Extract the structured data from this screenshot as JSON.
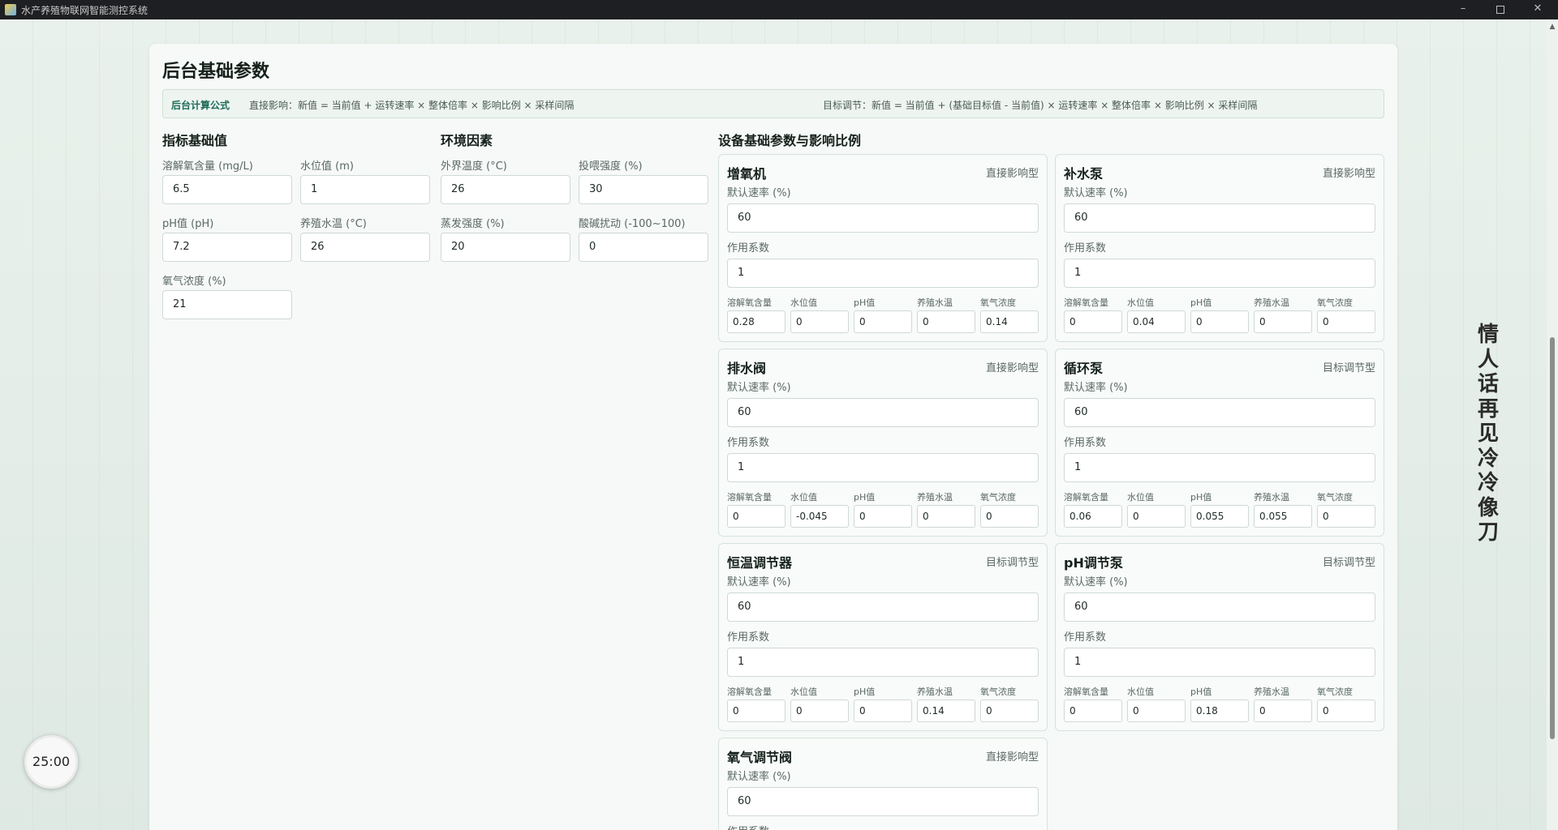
{
  "window": {
    "title": "水产养殖物联网智能测控系统",
    "minimize": "–",
    "close": "✕"
  },
  "page": {
    "title": "后台基础参数",
    "formula": {
      "label": "后台计算公式",
      "direct": "直接影响：新值 = 当前值 + 运转速率 × 整体倍率 × 影响比例 × 采样间隔",
      "target": "目标调节：新值 = 当前值 + (基础目标值 - 当前值) × 运转速率 × 整体倍率 × 影响比例 × 采样间隔"
    }
  },
  "indicators": {
    "title": "指标基础值",
    "fields": [
      {
        "label": "溶解氧含量 (mg/L)",
        "value": "6.5"
      },
      {
        "label": "水位值 (m)",
        "value": "1"
      },
      {
        "label": "pH值 (pH)",
        "value": "7.2"
      },
      {
        "label": "养殖水温 (°C)",
        "value": "26"
      },
      {
        "label": "氧气浓度 (%)",
        "value": "21"
      }
    ]
  },
  "environment": {
    "title": "环境因素",
    "fields": [
      {
        "label": "外界温度 (°C)",
        "value": "26"
      },
      {
        "label": "投喂强度 (%)",
        "value": "30"
      },
      {
        "label": "蒸发强度 (%)",
        "value": "20"
      },
      {
        "label": "酸碱扰动 (-100~100)",
        "value": "0"
      }
    ]
  },
  "devices": {
    "title": "设备基础参数与影响比例",
    "rate_label": "默认速率 (%)",
    "coef_label": "作用系数",
    "impact_labels": [
      "溶解氧含量",
      "水位值",
      "pH值",
      "养殖水温",
      "氧气浓度"
    ],
    "items": [
      {
        "name": "增氧机",
        "type": "直接影响型",
        "rate": "60",
        "coef": "1",
        "impacts": [
          "0.28",
          "0",
          "0",
          "0",
          "0.14"
        ]
      },
      {
        "name": "补水泵",
        "type": "直接影响型",
        "rate": "60",
        "coef": "1",
        "impacts": [
          "0",
          "0.04",
          "0",
          "0",
          "0"
        ]
      },
      {
        "name": "排水阀",
        "type": "直接影响型",
        "rate": "60",
        "coef": "1",
        "impacts": [
          "0",
          "-0.045",
          "0",
          "0",
          "0"
        ]
      },
      {
        "name": "循环泵",
        "type": "目标调节型",
        "rate": "60",
        "coef": "1",
        "impacts": [
          "0.06",
          "0",
          "0.055",
          "0.055",
          "0"
        ]
      },
      {
        "name": "恒温调节器",
        "type": "目标调节型",
        "rate": "60",
        "coef": "1",
        "impacts": [
          "0",
          "0",
          "0",
          "0.14",
          "0"
        ]
      },
      {
        "name": "pH调节泵",
        "type": "目标调节型",
        "rate": "60",
        "coef": "1",
        "impacts": [
          "0",
          "0",
          "0.18",
          "0",
          "0"
        ]
      },
      {
        "name": "氧气调节阀",
        "type": "直接影响型",
        "rate": "60",
        "coef": "",
        "impacts": [
          "",
          "",
          "",
          "",
          ""
        ]
      }
    ]
  },
  "side_text": "情人话再见冷冷像刀",
  "timer": "25:00"
}
